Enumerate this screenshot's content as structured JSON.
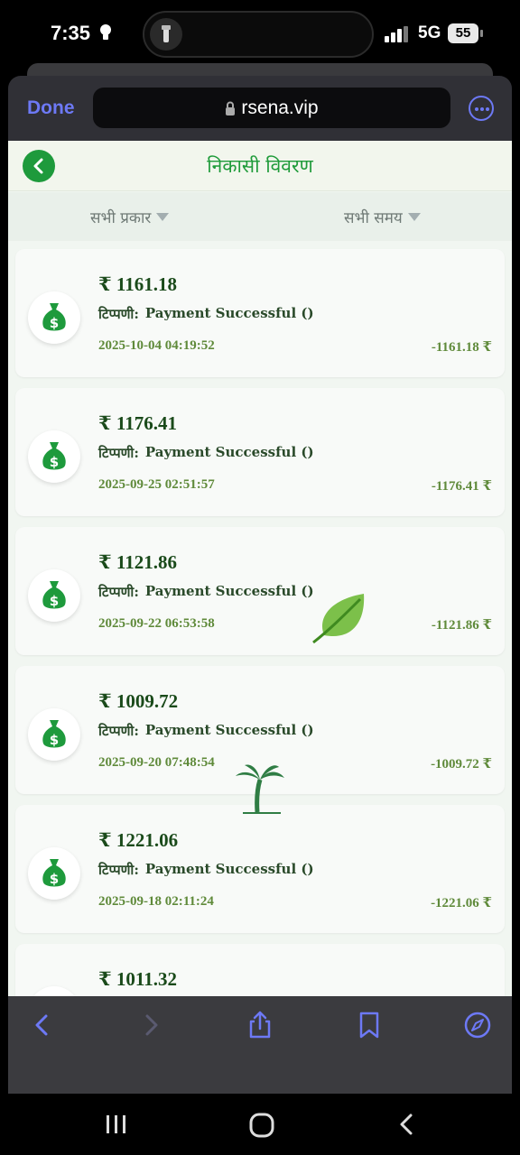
{
  "status_bar": {
    "time": "7:35",
    "network": "5G",
    "battery": "55"
  },
  "browser": {
    "done_label": "Done",
    "url": "rsena.vip"
  },
  "page": {
    "title": "निकासी विवरण",
    "filters": {
      "type_label": "सभी प्रकार",
      "time_label": "सभी समय"
    }
  },
  "transactions": [
    {
      "amount": "₹ 1161.18",
      "note_label": "टिप्पणी:",
      "note_text": "Payment Successful ()",
      "date": "2025-10-04 04:19:52",
      "delta": "-1161.18 ₹"
    },
    {
      "amount": "₹ 1176.41",
      "note_label": "टिप्पणी:",
      "note_text": "Payment Successful ()",
      "date": "2025-09-25 02:51:57",
      "delta": "-1176.41 ₹"
    },
    {
      "amount": "₹ 1121.86",
      "note_label": "टिप्पणी:",
      "note_text": "Payment Successful ()",
      "date": "2025-09-22 06:53:58",
      "delta": "-1121.86 ₹"
    },
    {
      "amount": "₹ 1009.72",
      "note_label": "टिप्पणी:",
      "note_text": "Payment Successful ()",
      "date": "2025-09-20 07:48:54",
      "delta": "-1009.72 ₹"
    },
    {
      "amount": "₹ 1221.06",
      "note_label": "टिप्पणी:",
      "note_text": "Payment Successful ()",
      "date": "2025-09-18 02:11:24",
      "delta": "-1221.06 ₹"
    },
    {
      "amount": "₹ 1011.32"
    }
  ],
  "colors": {
    "accent_green": "#1f9b3a",
    "safari_blue": "#6d79f5"
  },
  "icons": {
    "back": "chevron-left-icon",
    "money_bag": "money-bag-icon",
    "toolbar": [
      "back-arrow-icon",
      "forward-arrow-icon",
      "share-icon",
      "bookmarks-icon",
      "compass-icon"
    ]
  }
}
